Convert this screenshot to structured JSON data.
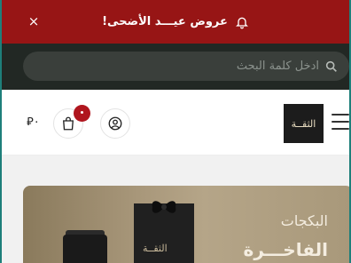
{
  "promo": {
    "text": "عروض عيـــد الأضحى!",
    "close_glyph": "×",
    "background": "#971515"
  },
  "search": {
    "placeholder": "ادخل كلمة البحث"
  },
  "header": {
    "currency": "⃁٠",
    "logo_text": "الثقــة"
  },
  "hero": {
    "title_line1": "البكجات",
    "title_line2": "الفاخـــرة",
    "bag_logo": "الثقــة"
  },
  "colors": {
    "accent": "#971515",
    "badge": "#b0161e",
    "search_bg": "#222824"
  },
  "icons": [
    "close-icon",
    "bell-icon",
    "search-icon",
    "cart-icon",
    "user-icon",
    "menu-icon"
  ]
}
